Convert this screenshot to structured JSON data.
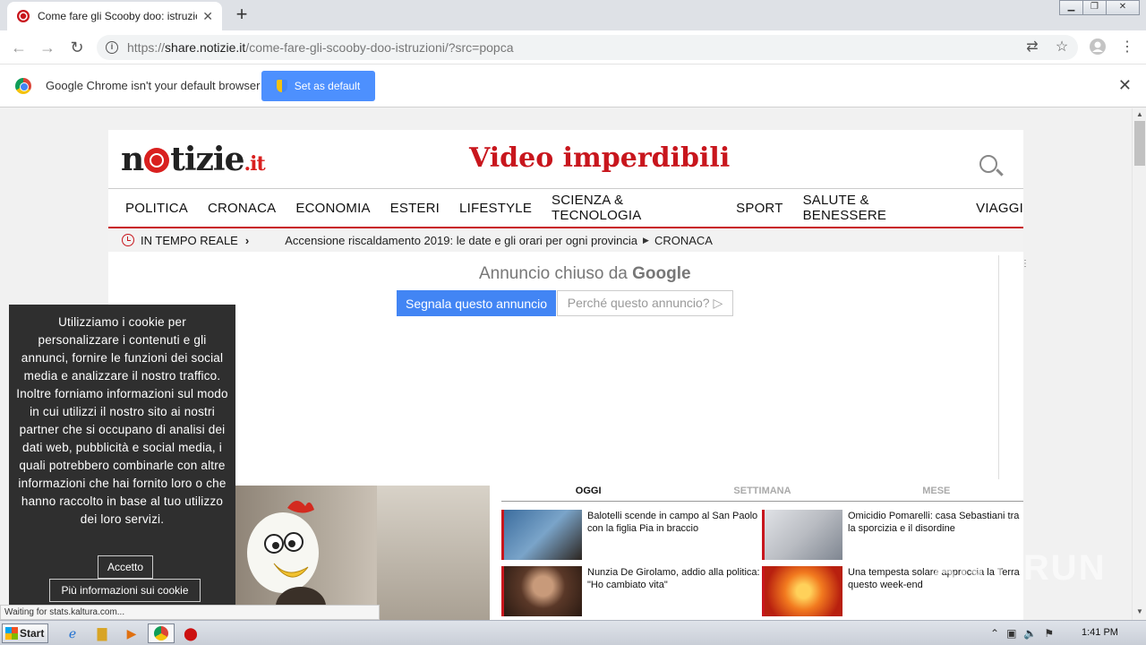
{
  "browser": {
    "tab_title": "Come fare gli Scooby doo: istruzioni",
    "new_tab": "+",
    "url_scheme": "https://",
    "url_host": "share.notizie.it",
    "url_path": "/come-fare-gli-scooby-doo-istruzioni/?src=popca",
    "window_controls": [
      "minimize-icon",
      "restore-icon",
      "close-icon"
    ]
  },
  "infobar": {
    "message": "Google Chrome isn't your default browser",
    "set_default_label": "Set as default"
  },
  "site": {
    "logo_main_1": "n",
    "logo_main_2": "tizie",
    "logo_tld": ".it",
    "headline": "Video imperdibili",
    "nav": [
      "POLITICA",
      "CRONACA",
      "ECONOMIA",
      "ESTERI",
      "LIFESTYLE",
      "SCIENZA & TECNOLOGIA",
      "SPORT",
      "SALUTE & BENESSERE",
      "VIAGGI"
    ],
    "ticker_label": "IN TEMPO REALE",
    "ticker_news": "Accensione riscaldamento 2019: le date e gli orari per ogni provincia",
    "ticker_category": "CRONACA"
  },
  "ad": {
    "closed_prefix": "Annuncio chiuso da",
    "closed_brand": "Google",
    "report_label": "Segnala questo annuncio",
    "why_label": "Perché questo annuncio? ▷"
  },
  "most_read": {
    "tabs": [
      "OGGI",
      "SETTIMANA",
      "MESE"
    ],
    "active_tab": "OGGI",
    "items": [
      {
        "text": "Balotelli scende in campo al San Paolo con la figlia Pia in braccio",
        "thumb_color": "#3c6d9e"
      },
      {
        "text": "Omicidio Pomarelli: casa Sebastiani tra la sporcizia e il disordine",
        "thumb_color": "#b9bcc2"
      },
      {
        "text": "Nunzia De Girolamo, addio alla politica: \"Ho cambiato vita\"",
        "thumb_color": "#5a3828"
      },
      {
        "text": "Una tempesta solare approccia la Terra questo week-end",
        "thumb_color": "#d8401a"
      }
    ]
  },
  "cookie": {
    "text": "Utilizziamo i cookie per personalizzare i contenuti e gli annunci, fornire le funzioni dei social media e analizzare il nostro traffico. Inoltre forniamo informazioni sul modo in cui utilizzi il nostro sito ai nostri partner che si occupano di analisi dei dati web, pubblicità e social media, i quali potrebbero combinarle con altre informazioni che hai fornito loro o che hanno raccolto in base al tuo utilizzo dei loro servizi.",
    "accept_label": "Accetto",
    "more_label": "Più informazioni sui cookie"
  },
  "status": "Waiting for stats.kaltura.com...",
  "watermark": "ANY RUN",
  "taskbar": {
    "start_label": "Start",
    "time": "1:41 PM"
  }
}
